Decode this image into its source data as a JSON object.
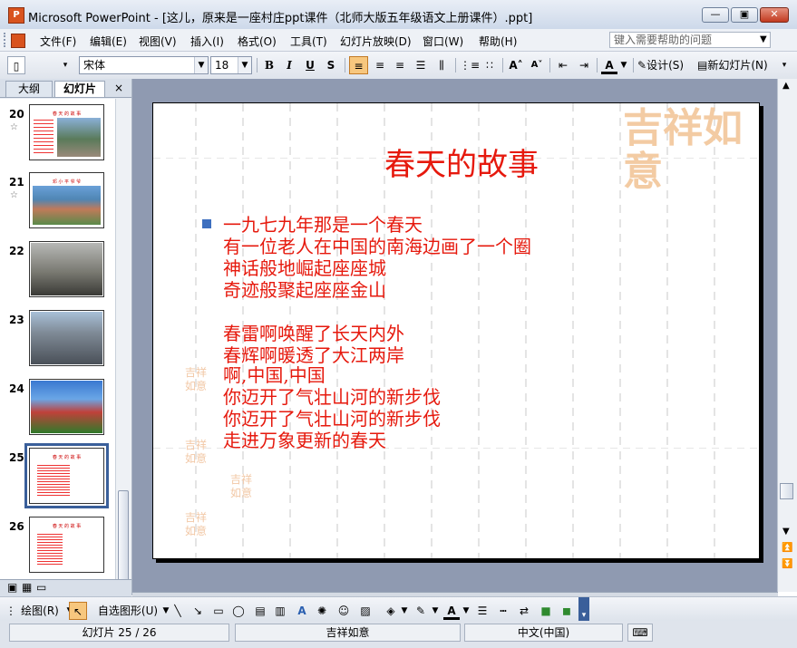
{
  "window": {
    "title": "Microsoft PowerPoint - [这儿，原来是一座村庄ppt课件（北师大版五年级语文上册课件）.ppt]",
    "app_icon": "powerpoint-icon"
  },
  "menu": {
    "items": [
      "文件(F)",
      "编辑(E)",
      "视图(V)",
      "插入(I)",
      "格式(O)",
      "工具(T)",
      "幻灯片放映(D)",
      "窗口(W)",
      "帮助(H)"
    ],
    "help_placeholder": "键入需要帮助的问题"
  },
  "toolbar": {
    "font_name": "宋体",
    "font_size": "18",
    "bold": "B",
    "italic": "I",
    "underline": "U",
    "shadow": "S",
    "font_color_label": "A",
    "design_label": "设计(S)",
    "new_slide_label": "新幻灯片(N)"
  },
  "left_pane": {
    "tabs": [
      "大纲",
      "幻灯片"
    ],
    "close_glyph": "×",
    "thumbnails": [
      {
        "num": "20",
        "star": "☆",
        "caption": "春 天 的 故 事"
      },
      {
        "num": "21",
        "star": "☆",
        "caption": "邓 小 平 爷 爷"
      },
      {
        "num": "22",
        "star": "",
        "caption": ""
      },
      {
        "num": "23",
        "star": "",
        "caption": ""
      },
      {
        "num": "24",
        "star": "",
        "caption": ""
      },
      {
        "num": "25",
        "star": "",
        "caption": "春 天 的 故 事"
      },
      {
        "num": "26",
        "star": "",
        "caption": "春 天 的 故 事"
      }
    ]
  },
  "slide": {
    "title": "春天的故事",
    "lines": [
      "一九七九年那是一个春天",
      "有一位老人在中国的南海边画了一个圈",
      "神话般地崛起座座城",
      "奇迹般聚起座座金山",
      "",
      "春雷啊唤醒了长天内外",
      "春辉啊暖透了大江两岸",
      "啊,中国,中国",
      "你迈开了气壮山河的新步伐",
      "你迈开了气壮山河的新步伐",
      "走进万象更新的春天"
    ],
    "logo_text": "吉祥如意",
    "seal_text": "吉祥如意"
  },
  "drawbar": {
    "draw_label": "绘图(R)",
    "autoshape_label": "自选图形(U)"
  },
  "status": {
    "slide_pos": "幻灯片 25 / 26",
    "design_name": "吉祥如意",
    "language": "中文(中国)"
  },
  "colors": {
    "slide_text": "#e6190d",
    "bullet": "#3d6fbf",
    "watermark": "#f3cba3"
  }
}
